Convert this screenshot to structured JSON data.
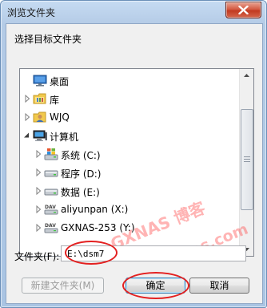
{
  "window": {
    "title": "浏览文件夹",
    "close_icon": "close-icon"
  },
  "dialog": {
    "prompt": "选择目标文件夹"
  },
  "tree": {
    "items": [
      {
        "label": "桌面",
        "icon": "desktop-icon",
        "expander": "none"
      },
      {
        "label": "库",
        "icon": "library-icon",
        "expander": "collapsed"
      },
      {
        "label": "WJQ",
        "icon": "user-icon",
        "expander": "collapsed"
      },
      {
        "label": "计算机",
        "icon": "computer-icon",
        "expander": "expanded"
      },
      {
        "label": "系统 (C:)",
        "icon": "windows-drive-icon",
        "expander": "collapsed"
      },
      {
        "label": "程序 (D:)",
        "icon": "drive-icon",
        "expander": "collapsed"
      },
      {
        "label": "数据 (E:)",
        "icon": "drive-icon",
        "expander": "collapsed"
      },
      {
        "label": "aliyunpan (X:)",
        "icon": "dav-drive-icon",
        "expander": "collapsed"
      },
      {
        "label": "GXNAS-253 (Y:)",
        "icon": "dav-drive-icon",
        "expander": "collapsed"
      }
    ],
    "dav_badge": "DAV"
  },
  "watermark": {
    "line1": "GXNAS 博客",
    "line2": "https://wp.gxnas.com"
  },
  "folder": {
    "label": "文件夹(F):",
    "value": "E:\\dsm7"
  },
  "buttons": {
    "new_folder": "新建文件夹(M)",
    "ok": "确定",
    "cancel": "取消"
  },
  "annotations": {
    "color": "#e32020"
  }
}
